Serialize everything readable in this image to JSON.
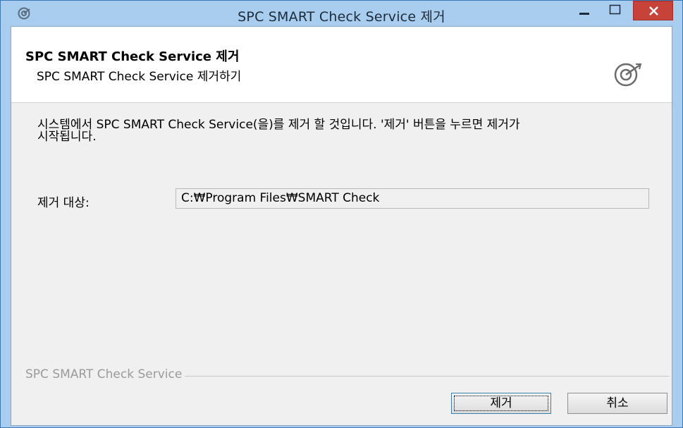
{
  "window": {
    "title": "SPC SMART Check Service 제거",
    "icon": "smart-check-logo-icon"
  },
  "header": {
    "title": "SPC SMART Check Service 제거",
    "subtitle": "SPC SMART Check Service 제거하기",
    "logo": "smart-check-logo-icon"
  },
  "body": {
    "description_line1": "시스템에서 SPC SMART Check Service(을)를 제거 할 것입니다. '제거' 버튼을 누르면 제거가",
    "description_line2": "시작됩니다.",
    "target_label": "제거 대상:",
    "target_path": "C:₩Program Files₩SMART Check"
  },
  "footer": {
    "group_label": "SPC SMART Check Service",
    "remove_label": "제거",
    "cancel_label": "취소"
  },
  "colors": {
    "titlebar": "#a9cdef",
    "close_button": "#c7433a",
    "dialog_bg": "#f0f0f0"
  }
}
